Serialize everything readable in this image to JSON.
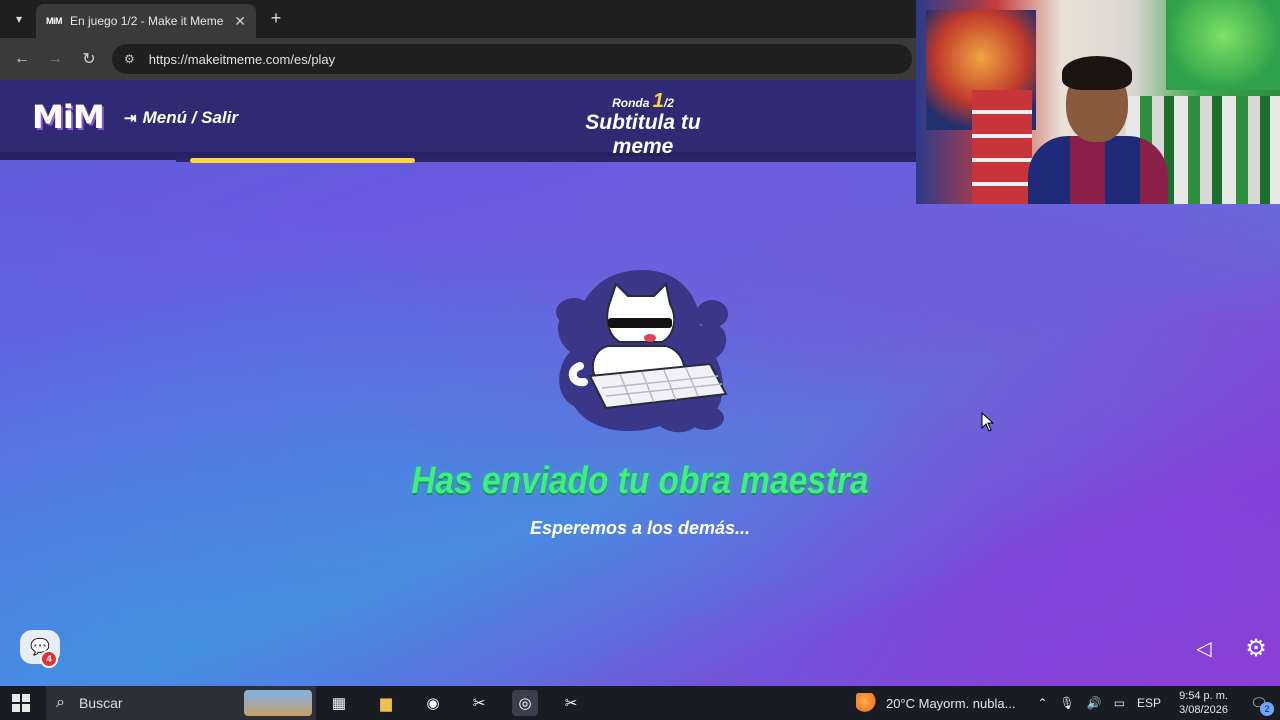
{
  "browser": {
    "tab_title": "En juego 1/2 - Make it Meme",
    "tab_favicon_text": "MiM",
    "url": "https://makeitmeme.com/es/play",
    "icons": [
      "tab-list-icon",
      "close-icon",
      "plus-icon",
      "back-icon",
      "forward-icon",
      "reload-icon",
      "site-settings-icon"
    ]
  },
  "game": {
    "logo": "MiM",
    "menu_label": "Menú / Salir",
    "round_label": "Ronda",
    "round_current": "1",
    "round_total": "/2",
    "round_title": "Subtitula tu meme",
    "progress_fraction": 0.31,
    "status_title": "Has enviado tu obra maestra",
    "status_subtitle": "Esperemos a los demás...",
    "chat_badge": "4",
    "colors": {
      "header": "#2f2a73",
      "progress": "#ffd43b",
      "title_green": "#3ef07e"
    }
  },
  "taskbar": {
    "search_placeholder": "Buscar",
    "weather": "20°C  Mayorm. nubla...",
    "language": "ESP",
    "time": "9:54 p. m.",
    "date": "3/08/2026",
    "notification_count": "2"
  }
}
